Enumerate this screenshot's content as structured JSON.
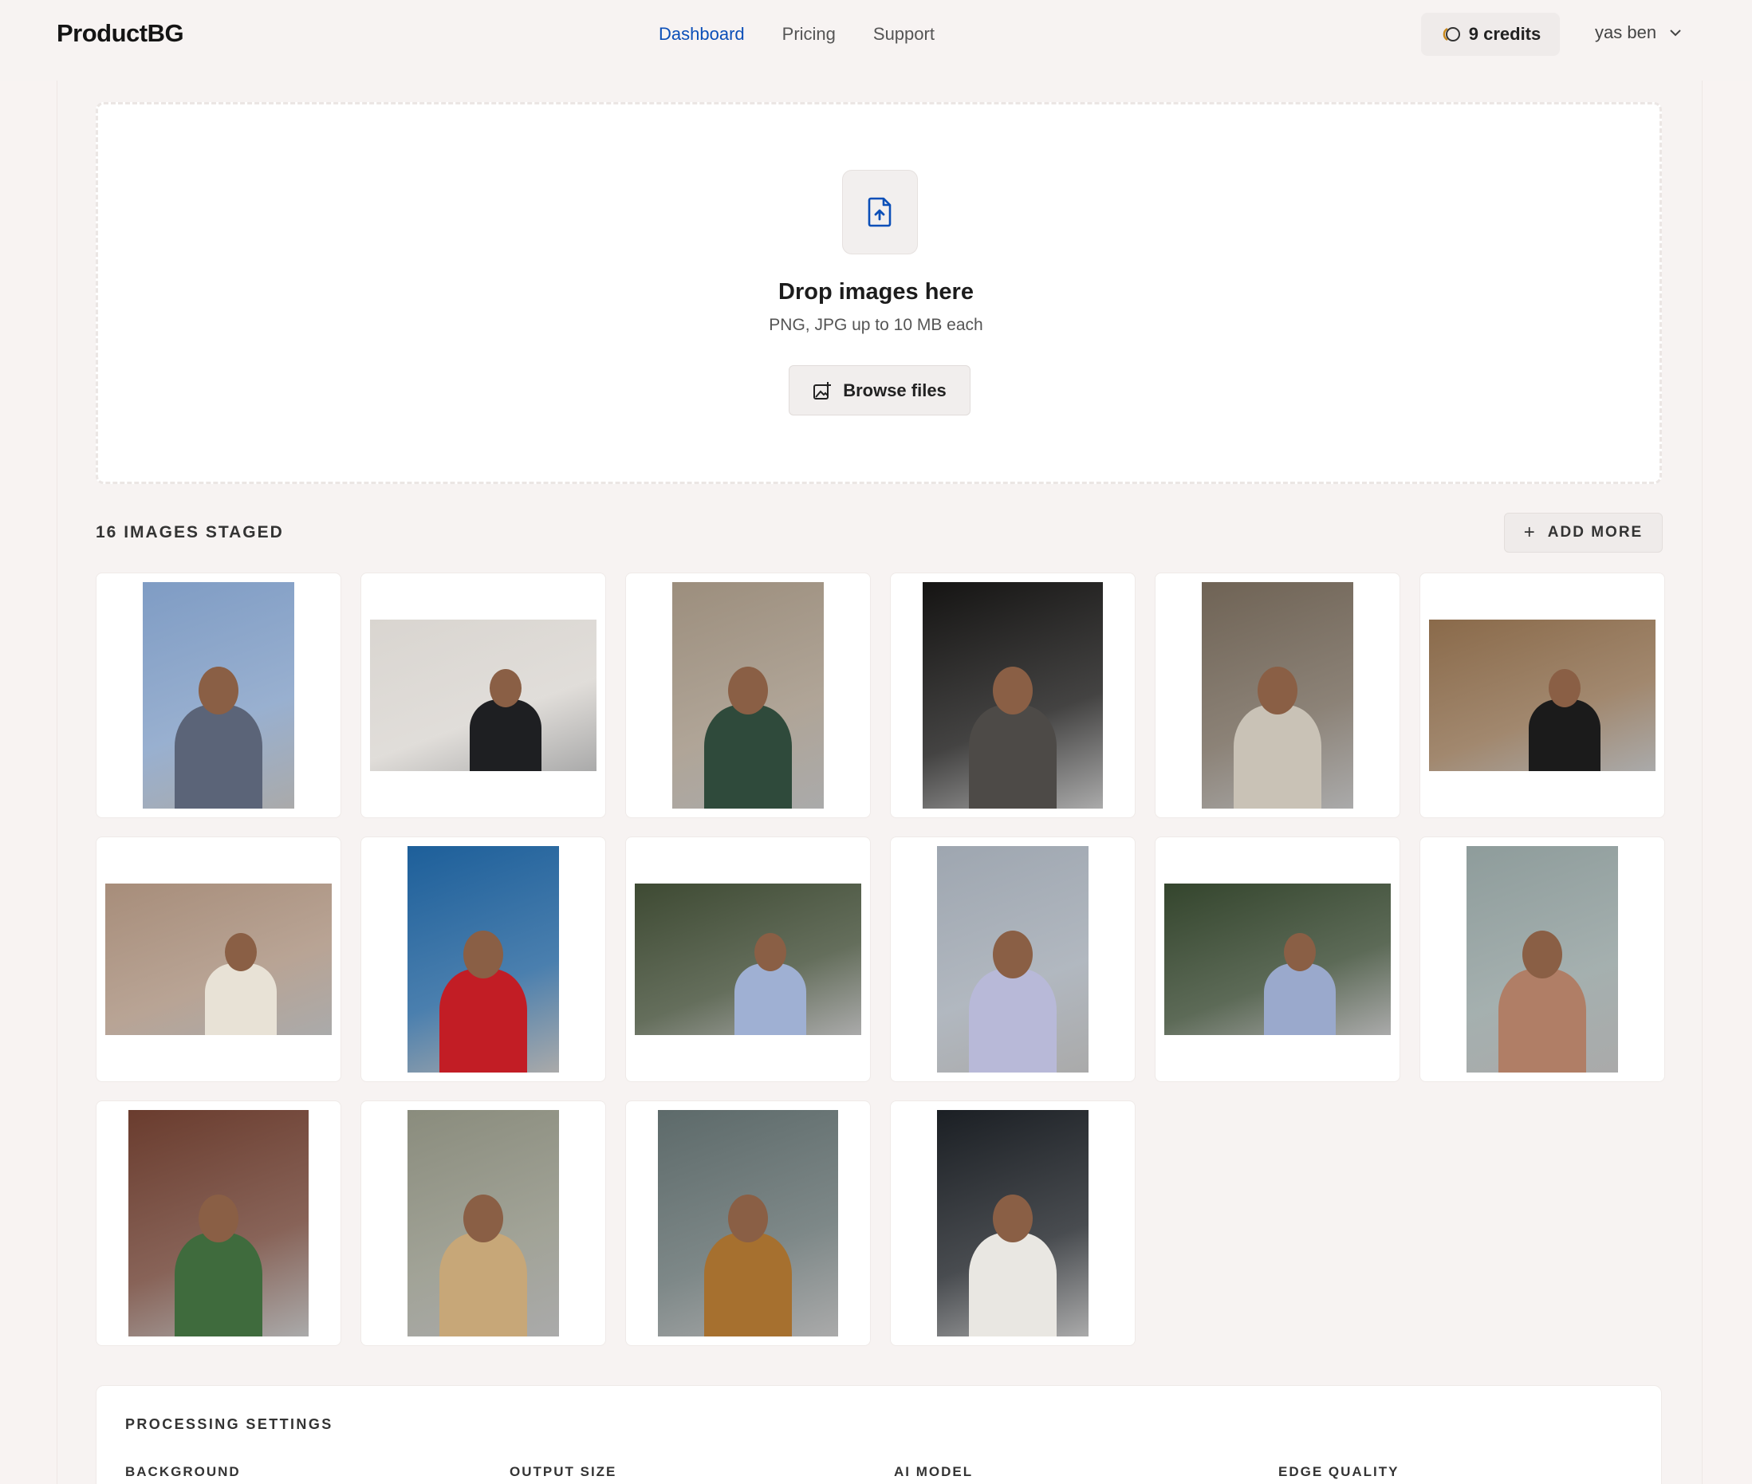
{
  "header": {
    "logo": "ProductBG",
    "nav": [
      {
        "label": "Dashboard",
        "active": true
      },
      {
        "label": "Pricing",
        "active": false
      },
      {
        "label": "Support",
        "active": false
      }
    ],
    "credits_label": "9 credits",
    "user_name": "yas ben"
  },
  "dropzone": {
    "title": "Drop images here",
    "subtitle": "PNG, JPG up to 10 MB each",
    "browse_label": "Browse files"
  },
  "staged": {
    "count_label": "16 IMAGES STAGED",
    "add_more_label": "ADD MORE"
  },
  "images": [
    {
      "desc": "man-beanie-sky",
      "bg": "#7f9cc4",
      "fg": "#5b6478"
    },
    {
      "desc": "man-cap-fence",
      "bg": "#d9d5d0",
      "fg": "#1e1f22"
    },
    {
      "desc": "man-green-suit-chairs",
      "bg": "#9c8e7d",
      "fg": "#2f4a3b"
    },
    {
      "desc": "man-suit-dark",
      "bg": "#151413",
      "fg": "#4d4a47"
    },
    {
      "desc": "man-store-jacket",
      "bg": "#6f6355",
      "fg": "#c9c2b6"
    },
    {
      "desc": "woman-grocery-aisle",
      "bg": "#8a6a4a",
      "fg": "#1b1b1b"
    },
    {
      "desc": "couple-desert-rocks",
      "bg": "#a78d7a",
      "fg": "#e8e2d6"
    },
    {
      "desc": "woman-red-dress-sea",
      "bg": "#1d5f9a",
      "fg": "#c21d25"
    },
    {
      "desc": "woman-sweater-bushes",
      "bg": "#3e4a33",
      "fg": "#9fb0d3"
    },
    {
      "desc": "woman-sweater-coast",
      "bg": "#9ea6b0",
      "fg": "#b8b9d8"
    },
    {
      "desc": "woman-sweater-greenery",
      "bg": "#34452d",
      "fg": "#9aa9cc"
    },
    {
      "desc": "woman-leaning-wall",
      "bg": "#8e9c9b",
      "fg": "#b07e66"
    },
    {
      "desc": "woman-green-jacket-brick",
      "bg": "#6a3c2e",
      "fg": "#3f6b3d"
    },
    {
      "desc": "woman-hat-wheat",
      "bg": "#8a8c7d",
      "fg": "#c7a778"
    },
    {
      "desc": "woman-sunflowers",
      "bg": "#5d6a6a",
      "fg": "#a6702f"
    },
    {
      "desc": "man-white-shirt-night",
      "bg": "#1b1f24",
      "fg": "#e9e7e2"
    }
  ],
  "settings": {
    "title": "PROCESSING SETTINGS",
    "labels": [
      "BACKGROUND",
      "OUTPUT SIZE",
      "AI MODEL",
      "EDGE QUALITY"
    ]
  },
  "colors": {
    "accent": "#0b4fb8",
    "page_bg": "#f7f3f2",
    "card_bg": "#ffffff"
  }
}
